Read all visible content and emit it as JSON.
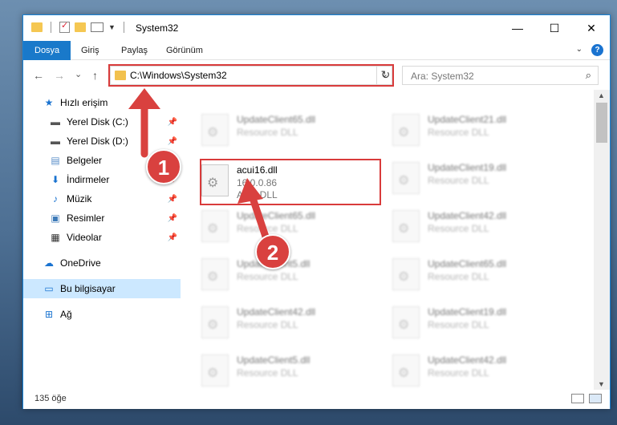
{
  "window": {
    "title": "System32",
    "controls": {
      "minimize": "—",
      "maximize": "☐",
      "close": "✕"
    }
  },
  "ribbon": {
    "tabs": [
      "Dosya",
      "Giriş",
      "Paylaş",
      "Görünüm"
    ],
    "help": "?"
  },
  "navigation": {
    "back": "←",
    "forward": "→",
    "recent": "⌄",
    "up": "↑",
    "address": "C:\\Windows\\System32",
    "search_placeholder": "Ara: System32"
  },
  "sidebar": {
    "items": [
      {
        "label": "Hızlı erişim",
        "icon": "star-icon"
      },
      {
        "label": "Yerel Disk (C:)",
        "icon": "drive-icon",
        "pinned": true
      },
      {
        "label": "Yerel Disk (D:)",
        "icon": "drive-icon",
        "pinned": true
      },
      {
        "label": "Belgeler",
        "icon": "documents-icon",
        "pinned": true
      },
      {
        "label": "İndirmeler",
        "icon": "download-icon",
        "pinned": true
      },
      {
        "label": "Müzik",
        "icon": "music-icon",
        "pinned": true
      },
      {
        "label": "Resimler",
        "icon": "pictures-icon",
        "pinned": true
      },
      {
        "label": "Videolar",
        "icon": "video-icon",
        "pinned": true
      },
      {
        "label": "OneDrive",
        "icon": "cloud-icon"
      },
      {
        "label": "Bu bilgisayar",
        "icon": "computer-icon",
        "selected": true
      },
      {
        "label": "Ağ",
        "icon": "network-icon"
      }
    ]
  },
  "files": {
    "highlighted": {
      "name": "acui16.dll",
      "version": "16.0.0.86",
      "description": "AcUi DLL"
    },
    "left_column": [
      {
        "name": "UpdateClient65.dll",
        "type": "Resource DLL"
      },
      {
        "name": "UpdateClient65.dll",
        "type": "Resource DLL"
      },
      {
        "name": "UpdateClient5.dll",
        "type": "Resource DLL"
      },
      {
        "name": "UpdateClient42.dll",
        "type": "Resource DLL"
      },
      {
        "name": "UpdateClient5.dll",
        "type": "Resource DLL"
      }
    ],
    "right_column": [
      {
        "name": "UpdateClient21.dll",
        "type": "Resource DLL"
      },
      {
        "name": "UpdateClient19.dll",
        "type": "Resource DLL"
      },
      {
        "name": "UpdateClient42.dll",
        "type": "Resource DLL"
      },
      {
        "name": "UpdateClient65.dll",
        "type": "Resource DLL"
      },
      {
        "name": "UpdateClient19.dll",
        "type": "Resource DLL"
      },
      {
        "name": "UpdateClient42.dll",
        "type": "Resource DLL"
      }
    ]
  },
  "status": {
    "item_count": "135 öğe"
  },
  "annotations": {
    "step1": "1",
    "step2": "2",
    "color": "#d9413f"
  }
}
